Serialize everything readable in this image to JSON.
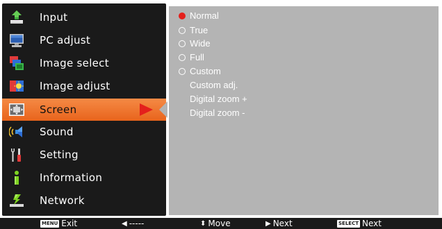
{
  "menu": {
    "items": [
      {
        "label": "Input",
        "icon": "input-arrow-icon"
      },
      {
        "label": "PC adjust",
        "icon": "monitor-icon"
      },
      {
        "label": "Image select",
        "icon": "image-select-icon"
      },
      {
        "label": "Image adjust",
        "icon": "image-adjust-icon"
      },
      {
        "label": "Screen",
        "icon": "screen-icon",
        "selected": true
      },
      {
        "label": "Sound",
        "icon": "speaker-icon"
      },
      {
        "label": "Setting",
        "icon": "wrench-icon"
      },
      {
        "label": "Information",
        "icon": "info-icon"
      },
      {
        "label": "Network",
        "icon": "network-icon"
      }
    ]
  },
  "screen_options": {
    "items": [
      {
        "label": "Normal",
        "type": "radio",
        "selected": true
      },
      {
        "label": "True",
        "type": "radio",
        "selected": false
      },
      {
        "label": "Wide",
        "type": "radio",
        "selected": false
      },
      {
        "label": "Full",
        "type": "radio",
        "selected": false
      },
      {
        "label": "Custom",
        "type": "radio",
        "selected": false
      },
      {
        "label": "Custom adj.",
        "type": "action"
      },
      {
        "label": "Digital zoom +",
        "type": "action"
      },
      {
        "label": "Digital zoom -",
        "type": "action"
      }
    ]
  },
  "help_bar": {
    "exit_key": "MENU",
    "exit_label": "Exit",
    "back_label": "-----",
    "move_label": "Move",
    "next_label": "Next",
    "select_key": "SELECT",
    "select_label": "Next"
  },
  "colors": {
    "menu_bg": "#1a1a1a",
    "submenu_bg": "#b4b4b4",
    "selected_bg": "#ef7a33",
    "accent_red": "#e4201c"
  }
}
